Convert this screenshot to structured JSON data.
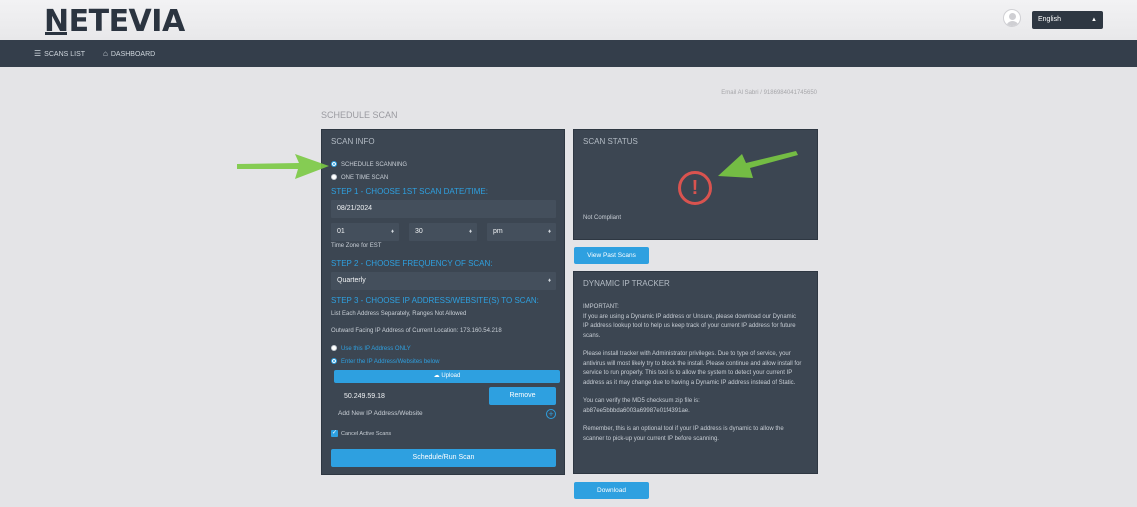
{
  "header": {
    "logo_text": "NETEVIA",
    "user_icon": "user-avatar-icon",
    "language": "English"
  },
  "nav": {
    "items": [
      {
        "label": "SCANS LIST",
        "icon": "list-icon"
      },
      {
        "label": "DASHBOARD",
        "icon": "home-icon"
      }
    ]
  },
  "account_info": "Email Al Sabri / 9186984041745650",
  "page_title": "SCHEDULE SCAN",
  "scan_info": {
    "title": "SCAN INFO",
    "option_schedule": "SCHEDULE SCANNING",
    "option_one_time": "ONE TIME SCAN",
    "step1": "STEP 1 - CHOOSE 1ST SCAN DATE/TIME:",
    "date_value": "08/21/2024",
    "hour": "01",
    "minute": "30",
    "ampm": "pm",
    "timezone": "Time Zone for EST",
    "step2": "STEP 2 - CHOOSE FREQUENCY OF SCAN:",
    "frequency": "Quarterly",
    "step3": "STEP 3 - CHOOSE IP ADDRESS/WEBSITE(S) TO SCAN:",
    "list_note": "List Each Address Separately, Ranges Not Allowed",
    "outward_ip": "Outward Facing IP Address of Current Location: 173.160.54.218",
    "option_use_ip": "Use this IP Address ONLY",
    "option_enter_ip": "Enter the IP Address/Websites below",
    "upload_label": "Upload",
    "ip_entry": "50.249.59.18",
    "remove_label": "Remove",
    "add_placeholder": "Add New IP Address/Website",
    "cancel_active": "Cancel Active Scans",
    "run_label": "Schedule/Run Scan"
  },
  "scan_status": {
    "title": "SCAN STATUS",
    "status": "Not Compliant",
    "status_icon": "warning-icon",
    "status_color": "#d9534f"
  },
  "view_past_label": "View Past Scans",
  "dynamic_ip": {
    "title": "DYNAMIC IP TRACKER",
    "p1": "IMPORTANT:",
    "p2": "If you are using a Dynamic IP address or Unsure, please download our Dynamic IP address lookup tool to help us keep track of your current IP address for future scans.",
    "p3": "Please install tracker with Administrator privileges. Due to type of service, your antivirus will most likely try to block the install. Please continue and allow install for service to run properly. This tool is to allow the system to detect your current IP address as it may change due to having a Dynamic IP address instead of Static.",
    "p4": "You can verify the MD5 checksum zip file is: ab87ee5bbbda6003a69987e01f4391ae.",
    "p5": "Remember, this is an optional tool if your IP address is dynamic to allow the scanner to pick-up your current IP before scanning."
  },
  "download_label": "Download",
  "colors": {
    "accent": "#2ea0e0",
    "panel": "#3c4652",
    "nav": "#343e4b",
    "arrow": "#7ac943"
  }
}
